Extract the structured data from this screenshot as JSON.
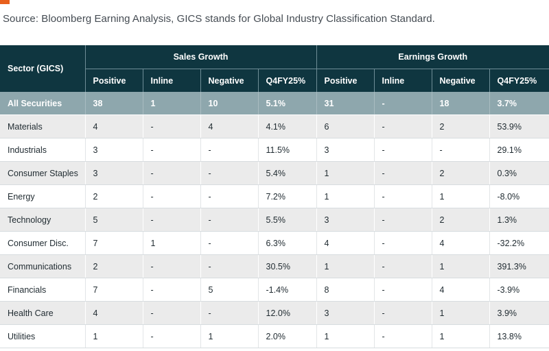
{
  "source_note": "Source: Bloomberg Earning Analysis,  GICS stands for Global Industry Classification Standard.",
  "colors": {
    "accent": "#e8601c",
    "header_bg": "#0f3640",
    "total_row_bg": "#8ea7ad",
    "stripe_bg": "#ebebeb"
  },
  "table": {
    "sector_header": "Sector (GICS)",
    "groups": [
      "Sales Growth",
      "Earnings Growth"
    ],
    "subheaders": [
      "Positive",
      "Inline",
      "Negative",
      "Q4FY25%",
      "Positive",
      "Inline",
      "Negative",
      "Q4FY25%"
    ],
    "rows": [
      [
        "All Securities",
        "38",
        "1",
        "10",
        "5.1%",
        "31",
        "-",
        "18",
        "3.7%"
      ],
      [
        "Materials",
        "4",
        "-",
        "4",
        "4.1%",
        "6",
        "-",
        "2",
        "53.9%"
      ],
      [
        "Industrials",
        "3",
        "-",
        "-",
        "11.5%",
        "3",
        "-",
        "-",
        "29.1%"
      ],
      [
        "Consumer Staples",
        "3",
        "-",
        "-",
        "5.4%",
        "1",
        "-",
        "2",
        "0.3%"
      ],
      [
        "Energy",
        "2",
        "-",
        "-",
        "7.2%",
        "1",
        "-",
        "1",
        "-8.0%"
      ],
      [
        "Technology",
        "5",
        "-",
        "-",
        "5.5%",
        "3",
        "-",
        "2",
        "1.3%"
      ],
      [
        "Consumer Disc.",
        "7",
        "1",
        "-",
        "6.3%",
        "4",
        "-",
        "4",
        "-32.2%"
      ],
      [
        "Communications",
        "2",
        "-",
        "-",
        "30.5%",
        "1",
        "-",
        "1",
        "391.3%"
      ],
      [
        "Financials",
        "7",
        "-",
        "5",
        "-1.4%",
        "8",
        "-",
        "4",
        "-3.9%"
      ],
      [
        "Health Care",
        "4",
        "-",
        "-",
        "12.0%",
        "3",
        "-",
        "1",
        "3.9%"
      ],
      [
        "Utilities",
        "1",
        "-",
        "1",
        "2.0%",
        "1",
        "-",
        "1",
        "13.8%"
      ]
    ]
  }
}
